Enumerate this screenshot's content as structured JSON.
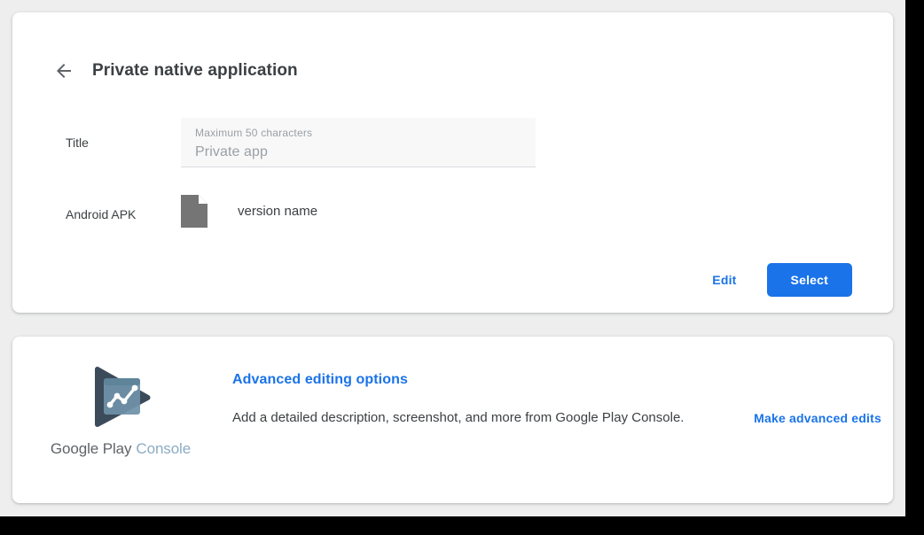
{
  "window": {
    "title": "Private native application"
  },
  "app_card": {
    "back_icon": "arrow-left-icon",
    "heading": "Private native application",
    "title_field": {
      "label": "Title",
      "hint": "Maximum 50 characters",
      "value": "Private app"
    },
    "apk_field": {
      "label": "Android APK",
      "file_icon": "file-document-icon",
      "version": "version name"
    },
    "actions": {
      "edit_label": "Edit",
      "select_label": "Select"
    }
  },
  "console_card": {
    "logo_icon": "google-play-console-logo",
    "wordmark_primary": "Google Play",
    "wordmark_secondary": "Console",
    "heading": "Advanced editing options",
    "description": "Add a detailed description, screenshot, and more from Google Play Console.",
    "link_label": "Make advanced edits"
  },
  "colors": {
    "accent_blue": "#1a73e8",
    "page_background": "#eeeeee",
    "card_background": "#ffffff",
    "text_primary": "#3c4043",
    "text_secondary": "#9aa0a6",
    "wordmark_secondary": "#8cabc4"
  }
}
